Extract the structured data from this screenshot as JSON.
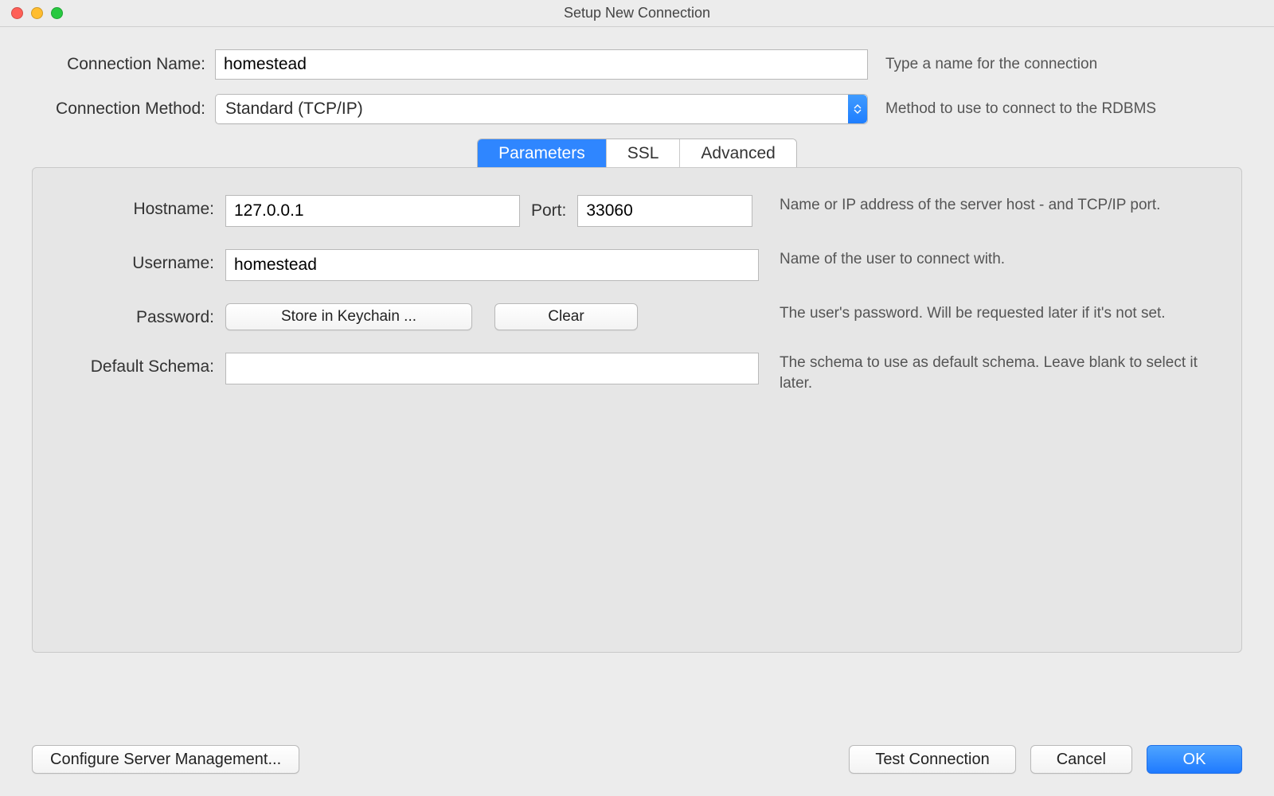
{
  "window": {
    "title": "Setup New Connection"
  },
  "top": {
    "connection_name_label": "Connection Name:",
    "connection_name_value": "homestead",
    "connection_name_hint": "Type a name for the connection",
    "connection_method_label": "Connection Method:",
    "connection_method_value": "Standard (TCP/IP)",
    "connection_method_hint": "Method to use to connect to the RDBMS"
  },
  "tabs": {
    "parameters": "Parameters",
    "ssl": "SSL",
    "advanced": "Advanced"
  },
  "params": {
    "hostname_label": "Hostname:",
    "hostname_value": "127.0.0.1",
    "port_label": "Port:",
    "port_value": "33060",
    "hostname_hint": "Name or IP address of the server host - and TCP/IP port.",
    "username_label": "Username:",
    "username_value": "homestead",
    "username_hint": "Name of the user to connect with.",
    "password_label": "Password:",
    "password_store_btn": "Store in Keychain ...",
    "password_clear_btn": "Clear",
    "password_hint": "The user's password. Will be requested later if it's not set.",
    "schema_label": "Default Schema:",
    "schema_value": "",
    "schema_hint": "The schema to use as default schema. Leave blank to select it later."
  },
  "footer": {
    "configure_btn": "Configure Server Management...",
    "test_btn": "Test Connection",
    "cancel_btn": "Cancel",
    "ok_btn": "OK"
  }
}
